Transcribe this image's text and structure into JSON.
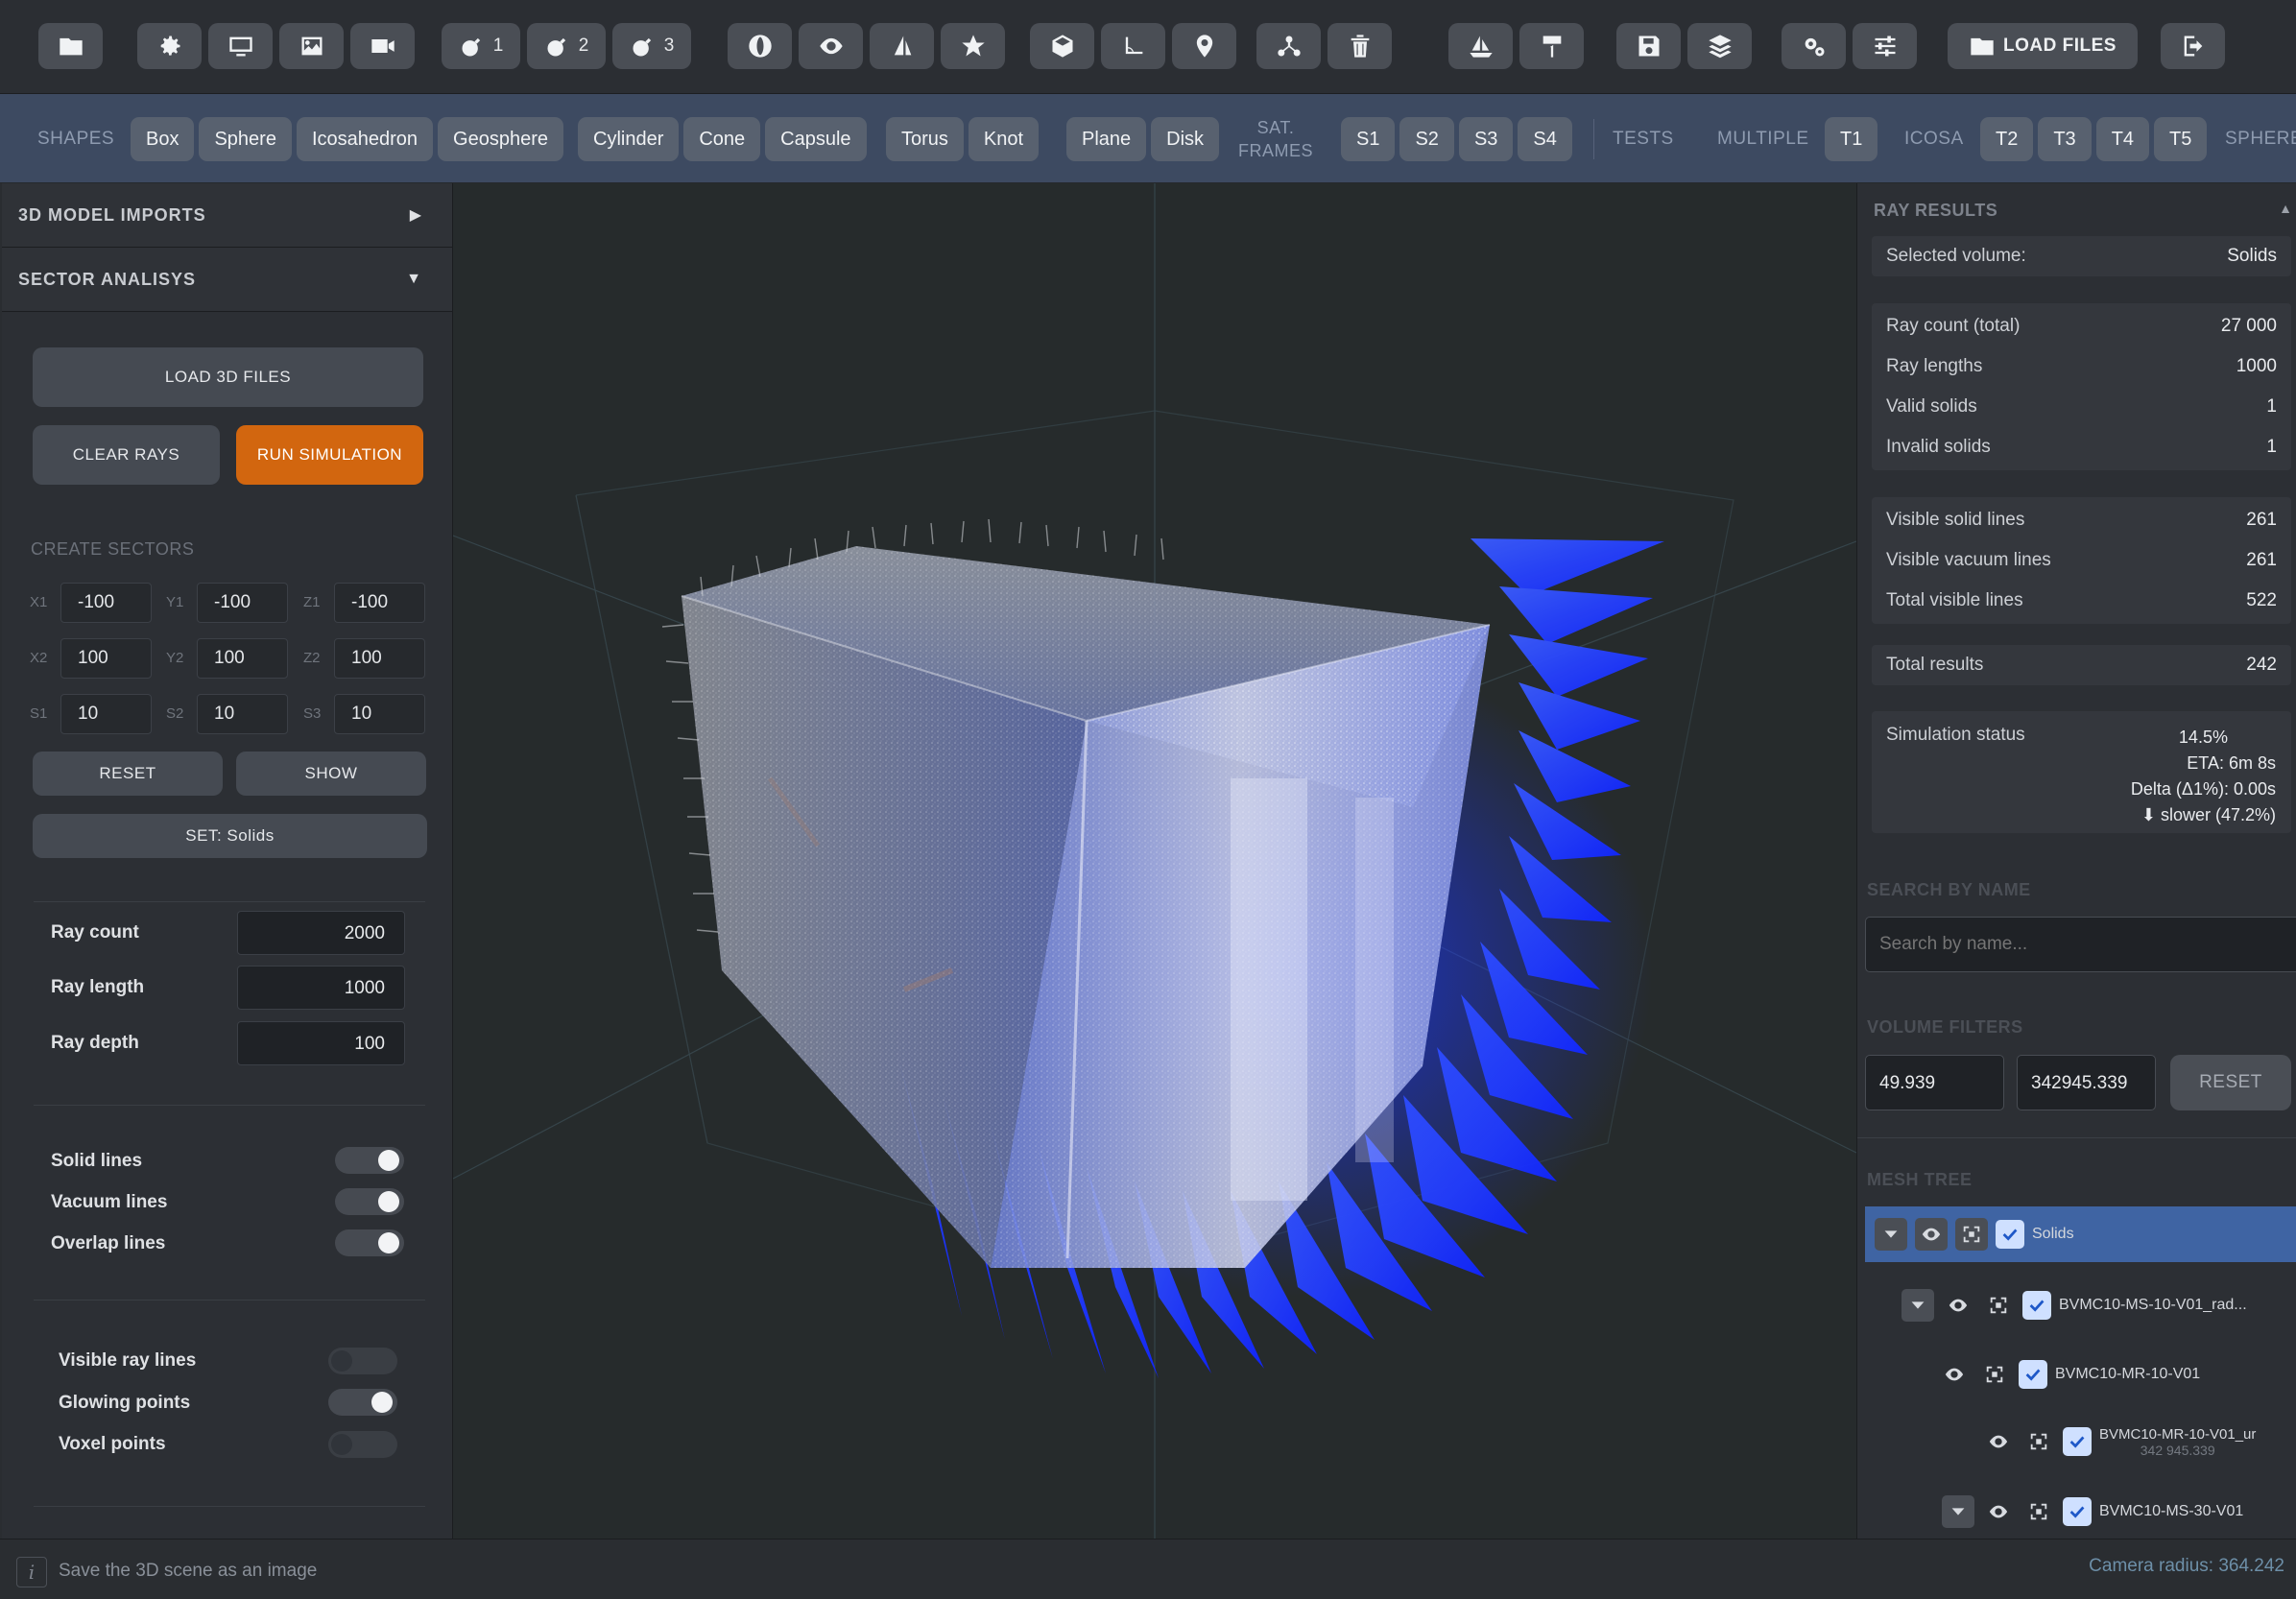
{
  "toolbar": {
    "bomb_numbers": [
      "1",
      "2",
      "3"
    ],
    "load_files_label": "LOAD FILES"
  },
  "shapes_bar": {
    "shapes_label": "SHAPES",
    "primitives": [
      "Box",
      "Sphere",
      "Icosahedron",
      "Geosphere"
    ],
    "round": [
      "Cylinder",
      "Cone",
      "Capsule"
    ],
    "twist": [
      "Torus",
      "Knot"
    ],
    "flat": [
      "Plane",
      "Disk"
    ],
    "sat_frames_label_1": "SAT.",
    "sat_frames_label_2": "FRAMES",
    "sat_frames": [
      "S1",
      "S2",
      "S3",
      "S4"
    ],
    "tests_label": "TESTS",
    "multiple_label": "MULTIPLE",
    "multiple": [
      "T1"
    ],
    "icosa_label": "ICOSA",
    "icosa": [
      "T2",
      "T3",
      "T4",
      "T5"
    ],
    "sphere_label": "SPHERE"
  },
  "left_panel": {
    "model_imports": "3D MODEL IMPORTS",
    "sector_analysis": "SECTOR ANALISYS",
    "load_3d_files": "LOAD 3D FILES",
    "clear_rays": "CLEAR RAYS",
    "run_simulation": "RUN SIMULATION",
    "create_sectors": "CREATE SECTORS",
    "coords": [
      [
        {
          "label": "X1",
          "value": "-100"
        },
        {
          "label": "Y1",
          "value": "-100"
        },
        {
          "label": "Z1",
          "value": "-100"
        }
      ],
      [
        {
          "label": "X2",
          "value": "100"
        },
        {
          "label": "Y2",
          "value": "100"
        },
        {
          "label": "Z2",
          "value": "100"
        }
      ],
      [
        {
          "label": "S1",
          "value": "10"
        },
        {
          "label": "S2",
          "value": "10"
        },
        {
          "label": "S3",
          "value": "10"
        }
      ]
    ],
    "reset": "RESET",
    "show": "SHOW",
    "set_solids": "SET: Solids",
    "params": [
      {
        "label": "Ray count",
        "value": "2000"
      },
      {
        "label": "Ray length",
        "value": "1000"
      },
      {
        "label": "Ray depth",
        "value": "100"
      }
    ],
    "line_toggles": [
      {
        "label": "Solid lines",
        "on": true
      },
      {
        "label": "Vacuum lines",
        "on": true
      },
      {
        "label": "Overlap lines",
        "on": true
      }
    ],
    "point_toggles": [
      {
        "label": "Visible ray lines",
        "on": false
      },
      {
        "label": "Glowing points",
        "on": true
      },
      {
        "label": "Voxel points",
        "on": false
      }
    ]
  },
  "right_panel": {
    "title": "RAY RESULTS",
    "selected_volume": {
      "label": "Selected volume:",
      "value": "Solids"
    },
    "counts": [
      {
        "label": "Ray count (total)",
        "value": "27 000"
      },
      {
        "label": "Ray lengths",
        "value": "1000"
      },
      {
        "label": "Valid solids",
        "value": "1"
      },
      {
        "label": "Invalid solids",
        "value": "1"
      }
    ],
    "lines": [
      {
        "label": "Visible solid lines",
        "value": "261"
      },
      {
        "label": "Visible vacuum lines",
        "value": "261"
      },
      {
        "label": "Total visible lines",
        "value": "522"
      }
    ],
    "total_results": {
      "label": "Total results",
      "value": "242"
    },
    "simulation": {
      "label": "Simulation status",
      "progress": "14.5%",
      "eta": "ETA: 6m 8s",
      "delta": "Delta (Δ1%): 0.00s",
      "speed": "⬇ slower (47.2%)"
    },
    "search_label": "SEARCH BY NAME",
    "search_placeholder": "Search by name...",
    "filters_label": "VOLUME FILTERS",
    "filter_min": "49.939",
    "filter_max": "342945.339",
    "filter_reset": "RESET",
    "mesh_tree_label": "MESH TREE",
    "tree": [
      {
        "name": "Solids",
        "sub": ""
      },
      {
        "name": "BVMC10-MS-10-V01_rad...",
        "sub": ""
      },
      {
        "name": "BVMC10-MR-10-V01",
        "sub": ""
      },
      {
        "name": "BVMC10-MR-10-V01_ur",
        "sub": "342 945.339"
      },
      {
        "name": "BVMC10-MS-30-V01",
        "sub": ""
      }
    ]
  },
  "status_bar": {
    "hint": "Save the 3D scene as an image",
    "camera_radius": "Camera radius: 364.242"
  },
  "colors": {
    "accent_orange": "#d2660f",
    "shapes_bar": "#3d4a61",
    "tree_selected": "#3f64a3",
    "ray_blue": "#1f3dff"
  }
}
